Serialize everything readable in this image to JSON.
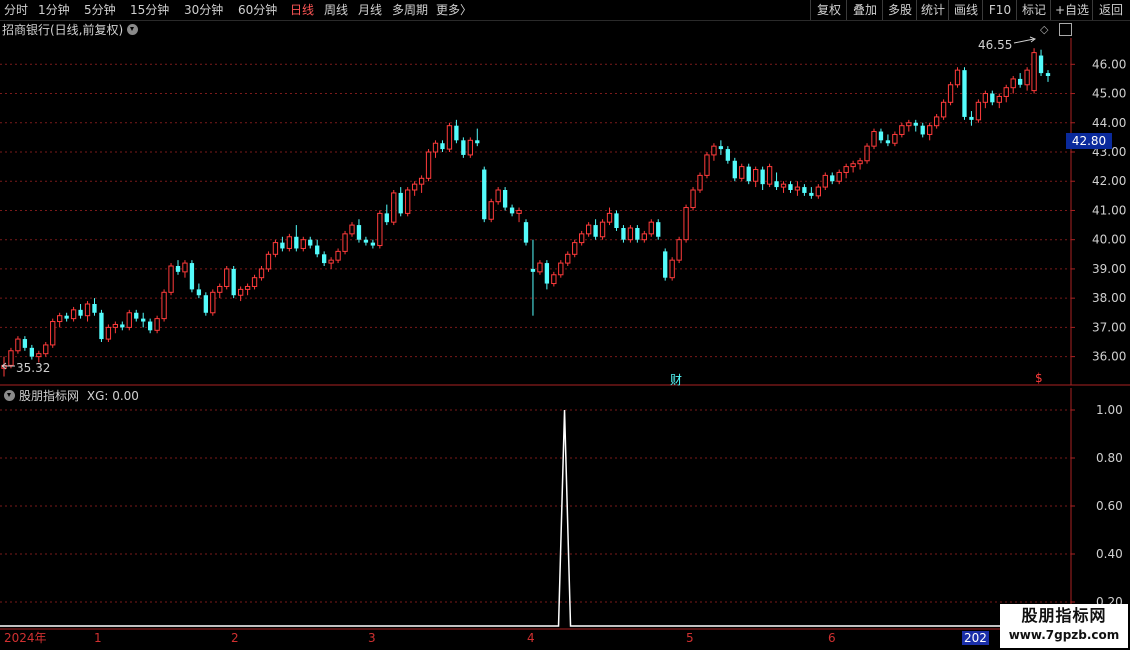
{
  "toolbar": {
    "periods": [
      "分时",
      "1分钟",
      "5分钟",
      "15分钟",
      "30分钟",
      "60分钟",
      "日线",
      "周线",
      "月线",
      "多周期",
      "更多"
    ],
    "active_period": "日线",
    "more_arrow": "〉",
    "right_buttons": [
      "复权",
      "叠加",
      "多股",
      "统计",
      "画线",
      "F10",
      "标记",
      "+自选",
      "返回"
    ]
  },
  "main_chart": {
    "title": "招商银行(日线,前复权)",
    "current_price_badge": "42.80",
    "high_label": "46.55",
    "low_label": "35.32",
    "finance_marker": "财",
    "dividend_marker": "$",
    "colors": {
      "up": "#ff3b3b",
      "down": "#54fcfc",
      "grid": "#7a1a1a"
    }
  },
  "indicator": {
    "title": "股朋指标网",
    "value_text": "XG: 0.00"
  },
  "watermark": {
    "line1": "股朋指标网",
    "line2": "www.7gpzb.com"
  },
  "date_axis": {
    "labels": [
      "2024年",
      "1",
      "2",
      "3",
      "4",
      "5",
      "6"
    ],
    "end_label": "202"
  },
  "chart_data": [
    {
      "type": "candlestick",
      "title": "",
      "ylim": [
        35.2,
        46.9
      ],
      "y_ticks": [
        "36.00",
        "37.00",
        "38.00",
        "39.00",
        "40.00",
        "41.00",
        "42.00",
        "43.00",
        "44.00",
        "45.00",
        "46.00"
      ],
      "grid": true,
      "annotations": [
        "46.55",
        "35.32"
      ],
      "candles": [
        [
          35.6,
          36.0,
          35.32,
          35.7
        ],
        [
          35.7,
          36.3,
          35.6,
          36.2
        ],
        [
          36.2,
          36.7,
          36.1,
          36.6
        ],
        [
          36.6,
          36.7,
          36.2,
          36.3
        ],
        [
          36.3,
          36.4,
          35.9,
          36.0
        ],
        [
          36.0,
          36.2,
          35.8,
          36.1
        ],
        [
          36.1,
          36.5,
          36.0,
          36.4
        ],
        [
          36.4,
          37.3,
          36.3,
          37.2
        ],
        [
          37.2,
          37.5,
          37.0,
          37.4
        ],
        [
          37.4,
          37.5,
          37.2,
          37.3
        ],
        [
          37.3,
          37.7,
          37.2,
          37.6
        ],
        [
          37.6,
          37.8,
          37.3,
          37.4
        ],
        [
          37.4,
          37.9,
          37.2,
          37.8
        ],
        [
          37.8,
          38.0,
          37.4,
          37.5
        ],
        [
          37.5,
          37.6,
          36.5,
          36.6
        ],
        [
          36.6,
          37.1,
          36.5,
          37.0
        ],
        [
          37.0,
          37.2,
          36.8,
          37.1
        ],
        [
          37.1,
          37.2,
          36.9,
          37.0
        ],
        [
          37.0,
          37.6,
          36.9,
          37.5
        ],
        [
          37.5,
          37.6,
          37.2,
          37.3
        ],
        [
          37.3,
          37.5,
          37.0,
          37.2
        ],
        [
          37.2,
          37.3,
          36.8,
          36.9
        ],
        [
          36.9,
          37.4,
          36.8,
          37.3
        ],
        [
          37.3,
          38.3,
          37.2,
          38.2
        ],
        [
          38.2,
          39.2,
          38.1,
          39.1
        ],
        [
          39.1,
          39.3,
          38.8,
          38.9
        ],
        [
          38.9,
          39.3,
          38.7,
          39.2
        ],
        [
          39.2,
          39.3,
          38.2,
          38.3
        ],
        [
          38.3,
          38.5,
          38.0,
          38.1
        ],
        [
          38.1,
          38.2,
          37.4,
          37.5
        ],
        [
          37.5,
          38.3,
          37.4,
          38.2
        ],
        [
          38.2,
          38.5,
          38.0,
          38.4
        ],
        [
          38.4,
          39.1,
          38.3,
          39.0
        ],
        [
          39.0,
          39.1,
          38.0,
          38.1
        ],
        [
          38.1,
          38.4,
          37.9,
          38.3
        ],
        [
          38.3,
          38.5,
          38.1,
          38.4
        ],
        [
          38.4,
          38.8,
          38.3,
          38.7
        ],
        [
          38.7,
          39.1,
          38.6,
          39.0
        ],
        [
          39.0,
          39.6,
          38.9,
          39.5
        ],
        [
          39.5,
          40.0,
          39.4,
          39.9
        ],
        [
          39.9,
          40.1,
          39.6,
          39.7
        ],
        [
          39.7,
          40.2,
          39.6,
          40.1
        ],
        [
          40.1,
          40.5,
          39.6,
          39.7
        ],
        [
          39.7,
          40.1,
          39.6,
          40.0
        ],
        [
          40.0,
          40.1,
          39.7,
          39.8
        ],
        [
          39.8,
          40.0,
          39.4,
          39.5
        ],
        [
          39.5,
          39.6,
          39.1,
          39.2
        ],
        [
          39.2,
          39.4,
          39.0,
          39.3
        ],
        [
          39.3,
          39.7,
          39.2,
          39.6
        ],
        [
          39.6,
          40.3,
          39.5,
          40.2
        ],
        [
          40.2,
          40.6,
          40.1,
          40.5
        ],
        [
          40.5,
          40.7,
          39.9,
          40.0
        ],
        [
          40.0,
          40.1,
          39.8,
          39.9
        ],
        [
          39.9,
          40.0,
          39.7,
          39.8
        ],
        [
          39.8,
          41.0,
          39.7,
          40.9
        ],
        [
          40.9,
          41.2,
          40.5,
          40.6
        ],
        [
          40.6,
          41.7,
          40.5,
          41.6
        ],
        [
          41.6,
          41.8,
          40.8,
          40.9
        ],
        [
          40.9,
          41.8,
          40.8,
          41.7
        ],
        [
          41.7,
          42.0,
          41.5,
          41.9
        ],
        [
          41.9,
          42.2,
          41.6,
          42.1
        ],
        [
          42.1,
          43.1,
          42.0,
          43.0
        ],
        [
          43.0,
          43.4,
          42.8,
          43.3
        ],
        [
          43.3,
          43.4,
          43.0,
          43.1
        ],
        [
          43.1,
          44.0,
          43.0,
          43.9
        ],
        [
          43.9,
          44.1,
          43.3,
          43.4
        ],
        [
          43.4,
          43.5,
          42.8,
          42.9
        ],
        [
          42.9,
          43.5,
          42.8,
          43.4
        ],
        [
          43.4,
          43.8,
          43.2,
          43.3
        ],
        [
          42.4,
          42.5,
          40.6,
          40.7
        ],
        [
          40.7,
          41.4,
          40.6,
          41.3
        ],
        [
          41.3,
          41.8,
          41.2,
          41.7
        ],
        [
          41.7,
          41.8,
          41.0,
          41.1
        ],
        [
          41.1,
          41.2,
          40.8,
          40.9
        ],
        [
          40.9,
          41.1,
          40.6,
          41.0
        ],
        [
          40.6,
          40.7,
          39.8,
          39.9
        ],
        [
          39.0,
          40.0,
          37.4,
          38.9
        ],
        [
          38.9,
          39.3,
          38.8,
          39.2
        ],
        [
          39.2,
          39.3,
          38.3,
          38.5
        ],
        [
          38.5,
          38.9,
          38.4,
          38.8
        ],
        [
          38.8,
          39.3,
          38.7,
          39.2
        ],
        [
          39.2,
          39.6,
          39.1,
          39.5
        ],
        [
          39.5,
          40.0,
          39.4,
          39.9
        ],
        [
          39.9,
          40.3,
          39.8,
          40.2
        ],
        [
          40.2,
          40.6,
          40.1,
          40.5
        ],
        [
          40.5,
          40.7,
          40.0,
          40.1
        ],
        [
          40.1,
          40.7,
          40.0,
          40.6
        ],
        [
          40.6,
          41.1,
          40.5,
          40.9
        ],
        [
          40.9,
          41.0,
          40.3,
          40.4
        ],
        [
          40.4,
          40.5,
          39.9,
          40.0
        ],
        [
          40.0,
          40.5,
          39.9,
          40.4
        ],
        [
          40.4,
          40.5,
          39.9,
          40.0
        ],
        [
          40.0,
          40.3,
          39.9,
          40.2
        ],
        [
          40.2,
          40.7,
          40.1,
          40.6
        ],
        [
          40.6,
          40.7,
          40.0,
          40.1
        ],
        [
          39.6,
          39.7,
          38.6,
          38.7
        ],
        [
          38.7,
          39.4,
          38.6,
          39.3
        ],
        [
          39.3,
          40.1,
          39.2,
          40.0
        ],
        [
          40.0,
          41.2,
          39.9,
          41.1
        ],
        [
          41.1,
          41.8,
          41.0,
          41.7
        ],
        [
          41.7,
          42.3,
          41.6,
          42.2
        ],
        [
          42.2,
          43.0,
          42.1,
          42.9
        ],
        [
          42.9,
          43.3,
          42.7,
          43.2
        ],
        [
          43.2,
          43.4,
          42.9,
          43.1
        ],
        [
          43.1,
          43.2,
          42.6,
          42.7
        ],
        [
          42.7,
          42.8,
          42.0,
          42.1
        ],
        [
          42.1,
          42.6,
          42.0,
          42.5
        ],
        [
          42.5,
          42.6,
          41.9,
          42.0
        ],
        [
          42.0,
          42.5,
          41.8,
          42.4
        ],
        [
          42.4,
          42.5,
          41.7,
          41.9
        ],
        [
          41.9,
          42.6,
          41.8,
          42.5
        ],
        [
          42.0,
          42.3,
          41.7,
          41.8
        ],
        [
          41.8,
          42.0,
          41.6,
          41.9
        ],
        [
          41.9,
          42.0,
          41.6,
          41.7
        ],
        [
          41.7,
          42.0,
          41.5,
          41.8
        ],
        [
          41.8,
          41.9,
          41.5,
          41.6
        ],
        [
          41.6,
          41.8,
          41.4,
          41.5
        ],
        [
          41.5,
          41.9,
          41.4,
          41.8
        ],
        [
          41.8,
          42.3,
          41.7,
          42.2
        ],
        [
          42.2,
          42.3,
          41.9,
          42.0
        ],
        [
          42.0,
          42.4,
          41.9,
          42.3
        ],
        [
          42.3,
          42.6,
          42.1,
          42.5
        ],
        [
          42.5,
          42.7,
          42.3,
          42.6
        ],
        [
          42.6,
          42.8,
          42.4,
          42.7
        ],
        [
          42.7,
          43.3,
          42.6,
          43.2
        ],
        [
          43.2,
          43.8,
          43.1,
          43.7
        ],
        [
          43.7,
          43.8,
          43.3,
          43.4
        ],
        [
          43.4,
          43.6,
          43.2,
          43.3
        ],
        [
          43.3,
          43.7,
          43.2,
          43.6
        ],
        [
          43.6,
          44.0,
          43.5,
          43.9
        ],
        [
          43.9,
          44.1,
          43.7,
          44.0
        ],
        [
          44.0,
          44.1,
          43.7,
          43.9
        ],
        [
          43.9,
          44.0,
          43.5,
          43.6
        ],
        [
          43.6,
          44.0,
          43.4,
          43.9
        ],
        [
          43.9,
          44.3,
          43.8,
          44.2
        ],
        [
          44.2,
          44.8,
          44.1,
          44.7
        ],
        [
          44.7,
          45.4,
          44.6,
          45.3
        ],
        [
          45.3,
          45.9,
          45.2,
          45.8
        ],
        [
          45.8,
          45.9,
          44.1,
          44.2
        ],
        [
          44.2,
          44.4,
          43.9,
          44.1
        ],
        [
          44.1,
          44.8,
          44.0,
          44.7
        ],
        [
          44.7,
          45.1,
          44.5,
          45.0
        ],
        [
          45.0,
          45.1,
          44.6,
          44.7
        ],
        [
          44.7,
          45.0,
          44.5,
          44.9
        ],
        [
          44.9,
          45.3,
          44.7,
          45.2
        ],
        [
          45.2,
          45.6,
          45.0,
          45.5
        ],
        [
          45.5,
          45.7,
          45.2,
          45.3
        ],
        [
          45.3,
          45.9,
          45.1,
          45.8
        ],
        [
          45.1,
          46.55,
          45.0,
          46.4
        ],
        [
          46.3,
          46.5,
          45.6,
          45.7
        ],
        [
          45.7,
          45.8,
          45.4,
          45.6
        ]
      ]
    },
    {
      "type": "line",
      "title": "",
      "name": "XG",
      "ylim": [
        0.1,
        1.05
      ],
      "y_ticks": [
        "0.20",
        "0.40",
        "0.60",
        "0.80",
        "1.00"
      ],
      "grid": true,
      "x_count": 150,
      "signal_index": 80,
      "signal_value": 1.0
    }
  ]
}
